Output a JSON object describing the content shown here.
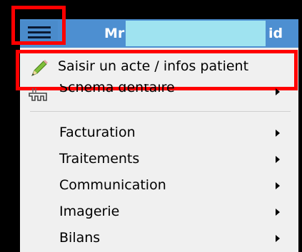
{
  "window": {
    "title_prefix": "Mr",
    "title_suffix": "id"
  },
  "menu": {
    "items": [
      {
        "label": "Saisir un acte / infos patient",
        "icon": "pencil-icon",
        "has_submenu": false
      },
      {
        "label": "Schéma dentaire",
        "icon": "tooth-chart-icon",
        "has_submenu": true
      },
      {
        "label": "Facturation",
        "has_submenu": true
      },
      {
        "label": "Traitements",
        "has_submenu": true
      },
      {
        "label": "Communication",
        "has_submenu": true
      },
      {
        "label": "Imagerie",
        "has_submenu": true
      },
      {
        "label": "Bilans",
        "has_submenu": true
      }
    ]
  },
  "colors": {
    "titlebar": "#4d8fd1",
    "menu_bg": "#f0f0f0",
    "highlight_outline": "#ff0000",
    "redaction": "#9fe3f0"
  }
}
